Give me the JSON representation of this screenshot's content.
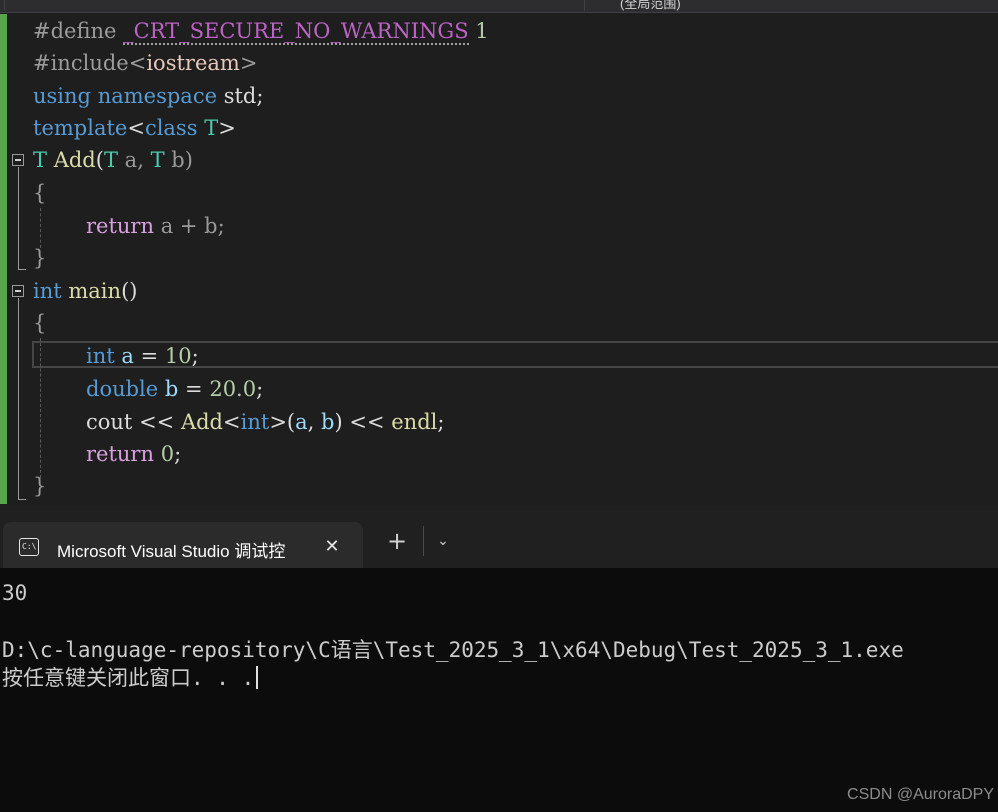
{
  "editor": {
    "scope_label": "(全局范围)",
    "code": {
      "l1_define": "#define",
      "l1_macro": "_CRT_SECURE_NO_WARNINGS",
      "l1_value": "1",
      "l2_include": "#include",
      "l2_lt": "<",
      "l2_header": "iostream",
      "l2_gt": ">",
      "l3_using": "using",
      "l3_namespace": "namespace",
      "l3_std": "std;",
      "l4_template": "template",
      "l4_lt": "<",
      "l4_class": "class",
      "l4_T": "T",
      "l4_gt": ">",
      "l5_T": "T",
      "l5_add": "Add",
      "l5_paren": "(",
      "l5_T1": "T",
      "l5_a": "a,",
      "l5_T2": "T",
      "l5_b": "b)",
      "l6_brace": "{",
      "l7_return": "return",
      "l7_expr": "a + b;",
      "l8_brace": "}",
      "l9_int": "int",
      "l9_main": "main",
      "l9_parens": "()",
      "l10_brace": "{",
      "l11_int": "int",
      "l11_a": "a",
      "l11_eq": "=",
      "l11_num": "10",
      "l11_semi": ";",
      "l12_double": "double",
      "l12_b": "b",
      "l12_eq": "=",
      "l12_num": "20.0",
      "l12_semi": ";",
      "l13_cout": "cout",
      "l13_op1": "<<",
      "l13_add": "Add",
      "l13_lt": "<",
      "l13_int": "int",
      "l13_gt": ">(",
      "l13_a": "a",
      "l13_comma": ",",
      "l13_b": "b",
      "l13_close": ")",
      "l13_op2": "<<",
      "l13_endl": "endl",
      "l13_semi": ";",
      "l14_return": "return",
      "l14_num": "0",
      "l14_semi": ";",
      "l15_brace": "}"
    }
  },
  "terminal": {
    "tab_title": "Microsoft Visual Studio 调试控",
    "tab_icon_text": "C:\\",
    "close_glyph": "✕",
    "new_tab_glyph": "+",
    "dropdown_glyph": "⌄",
    "output_line_1": "30",
    "output_line_2": "D:\\c-language-repository\\C语言\\Test_2025_3_1\\x64\\Debug\\Test_2025_3_1.exe",
    "output_line_3": "按任意键关闭此窗口. . ."
  },
  "watermark": "CSDN @AuroraDPY",
  "colors": {
    "keyword": "#569cd6",
    "control_keyword": "#d8a0df",
    "type_param": "#4ec9b0",
    "function": "#dcdcaa",
    "variable": "#9cdcfe",
    "number": "#b5cea8",
    "change_bar": "#57a64a"
  }
}
